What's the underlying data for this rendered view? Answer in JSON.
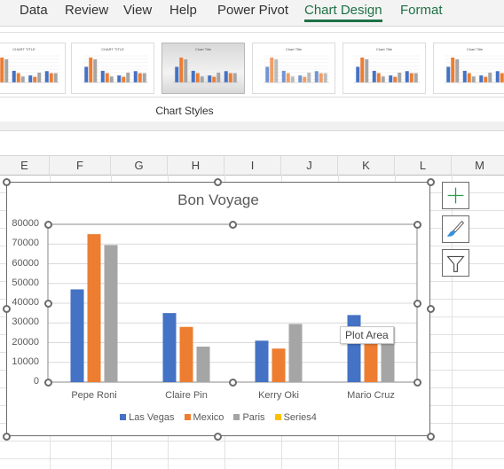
{
  "ribbon": {
    "tabs": [
      {
        "label": "Data",
        "active": false
      },
      {
        "label": "Review",
        "active": false
      },
      {
        "label": "View",
        "active": false
      },
      {
        "label": "Help",
        "active": false
      },
      {
        "label": "Power Pivot",
        "active": false
      },
      {
        "label": "Chart Design",
        "active": true
      },
      {
        "label": "Format",
        "active": false
      }
    ],
    "chart_styles_group_label": "Chart Styles",
    "chart_style_thumbnails": [
      {
        "name": "chart-style-1",
        "selected": false
      },
      {
        "name": "chart-style-2",
        "selected": false
      },
      {
        "name": "chart-style-3",
        "selected": true
      },
      {
        "name": "chart-style-4",
        "selected": false
      },
      {
        "name": "chart-style-5",
        "selected": false
      },
      {
        "name": "chart-style-6",
        "selected": false
      }
    ]
  },
  "sheet": {
    "columns": [
      "E",
      "F",
      "G",
      "H",
      "I",
      "J",
      "K",
      "L",
      "M"
    ]
  },
  "side_buttons": [
    {
      "name": "chart-elements-button",
      "icon": "plus-icon"
    },
    {
      "name": "chart-styles-button",
      "icon": "paintbrush-icon"
    },
    {
      "name": "chart-filters-button",
      "icon": "funnel-icon"
    }
  ],
  "tooltip": "Plot Area",
  "colors": {
    "Las Vegas": "#4472c4",
    "Mexico": "#ed7d31",
    "Paris": "#a5a5a5",
    "Series4": "#ffc000",
    "accent": "#1e7145"
  },
  "chart_data": {
    "type": "bar",
    "title": "Bon Voyage",
    "xlabel": "",
    "ylabel": "",
    "categories": [
      "Pepe Roni",
      "Claire Pin",
      "Kerry Oki",
      "Mario Cruz"
    ],
    "series": [
      {
        "name": "Las Vegas",
        "values": [
          47000,
          35000,
          21000,
          34000
        ]
      },
      {
        "name": "Mexico",
        "values": [
          75000,
          28000,
          17000,
          28000
        ]
      },
      {
        "name": "Paris",
        "values": [
          69500,
          18000,
          29500,
          28000
        ]
      },
      {
        "name": "Series4",
        "values": [
          null,
          null,
          null,
          null
        ]
      }
    ],
    "ylim": [
      0,
      80000
    ],
    "yticks": [
      0,
      10000,
      20000,
      30000,
      40000,
      50000,
      60000,
      70000,
      80000
    ],
    "grid": true,
    "legend_position": "bottom"
  }
}
